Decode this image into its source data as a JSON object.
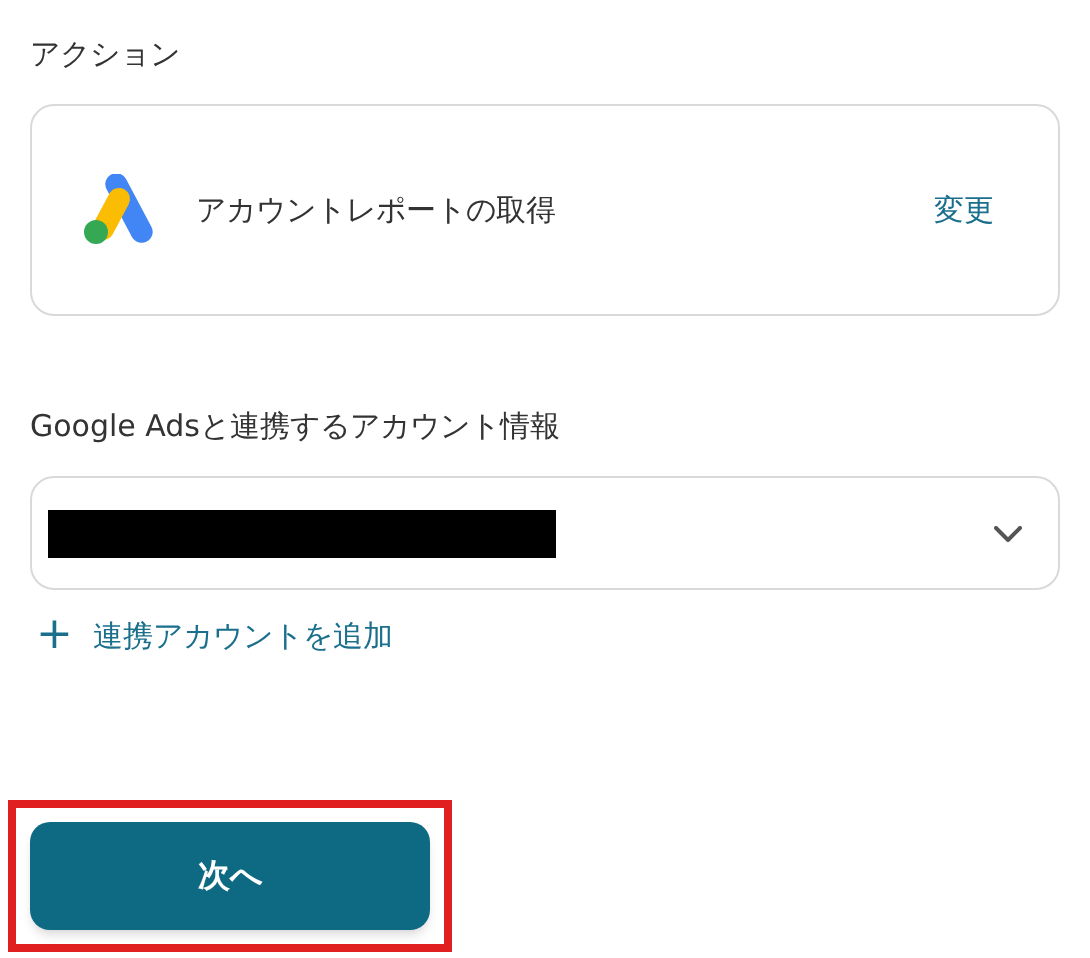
{
  "action_section": {
    "label": "アクション",
    "action_name": "アカウントレポートの取得",
    "change_link": "変更"
  },
  "account_section": {
    "label": "Google Adsと連携するアカウント情報",
    "value_redacted": true,
    "add_link": {
      "icon": "+",
      "label": "連携アカウントを追加"
    }
  },
  "next_button": {
    "label": "次へ",
    "highlighted": true
  }
}
